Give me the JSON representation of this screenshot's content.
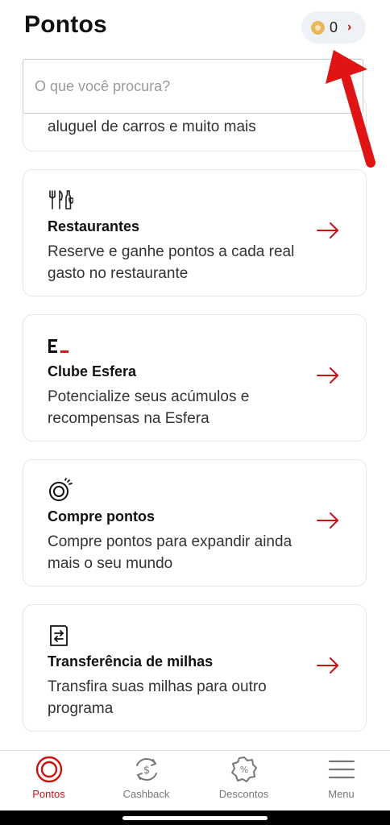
{
  "header": {
    "title": "Pontos",
    "points_value": "0",
    "points_chevron": "›"
  },
  "search": {
    "placeholder": "O que você procura?"
  },
  "partial_card": {
    "text": "aluguel de carros e muito mais"
  },
  "cards": [
    {
      "icon": "restaurant-icon",
      "title": "Restaurantes",
      "description": "Reserve e ganhe pontos a cada real gasto no restaurante"
    },
    {
      "icon": "esfera-logo-icon",
      "title": "Clube Esfera",
      "description": "Potencialize seus acúmulos e recompensas na Esfera"
    },
    {
      "icon": "buy-points-icon",
      "title": "Compre pontos",
      "description": "Compre pontos para expandir ainda mais o seu mundo"
    },
    {
      "icon": "transfer-miles-icon",
      "title": "Transferência de milhas",
      "description": "Transfira suas milhas para outro programa"
    }
  ],
  "nav": [
    {
      "label": "Pontos",
      "icon": "points-target-icon",
      "active": true
    },
    {
      "label": "Cashback",
      "icon": "cashback-icon",
      "active": false
    },
    {
      "label": "Descontos",
      "icon": "discount-badge-icon",
      "active": false
    },
    {
      "label": "Menu",
      "icon": "hamburger-menu-icon",
      "active": false
    }
  ],
  "colors": {
    "accent": "#cc1111",
    "annotation_arrow": "#e01414",
    "coin": "#e8b75a",
    "pill_bg": "#eef2f6"
  }
}
